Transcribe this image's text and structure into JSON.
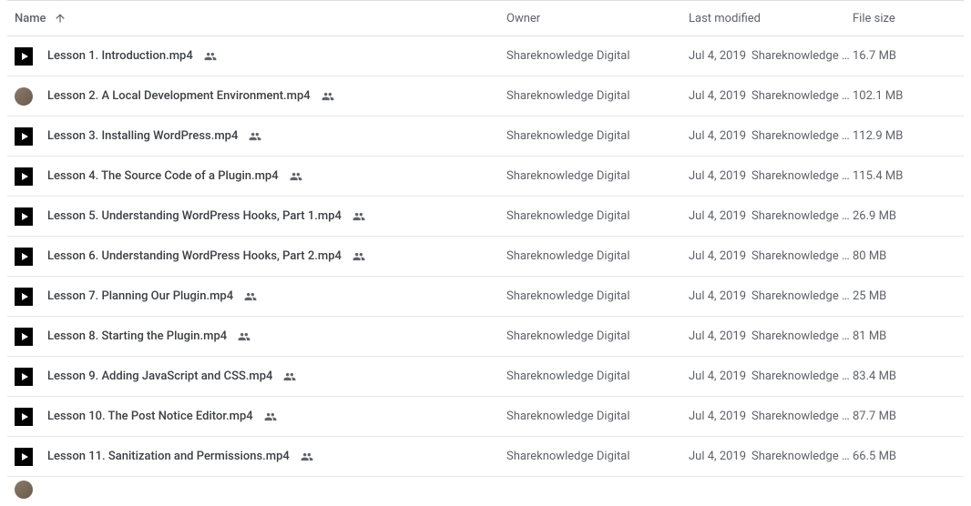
{
  "columns": {
    "name": "Name",
    "owner": "Owner",
    "modified": "Last modified",
    "size": "File size"
  },
  "files": [
    {
      "icon": "video",
      "name": "Lesson 1. Introduction.mp4",
      "shared": true,
      "owner": "Shareknowledge Digital",
      "modified_date": "Jul 4, 2019",
      "modified_by": "Shareknowledge Di…",
      "size": "16.7 MB"
    },
    {
      "icon": "round",
      "name": "Lesson 2. A Local Development Environment.mp4",
      "shared": true,
      "owner": "Shareknowledge Digital",
      "modified_date": "Jul 4, 2019",
      "modified_by": "Shareknowledge Di…",
      "size": "102.1 MB"
    },
    {
      "icon": "video",
      "name": "Lesson 3. Installing WordPress.mp4",
      "shared": true,
      "owner": "Shareknowledge Digital",
      "modified_date": "Jul 4, 2019",
      "modified_by": "Shareknowledge Di…",
      "size": "112.9 MB"
    },
    {
      "icon": "video",
      "name": "Lesson 4. The Source Code of a Plugin.mp4",
      "shared": true,
      "owner": "Shareknowledge Digital",
      "modified_date": "Jul 4, 2019",
      "modified_by": "Shareknowledge Di…",
      "size": "115.4 MB"
    },
    {
      "icon": "video",
      "name": "Lesson 5. Understanding WordPress Hooks, Part 1.mp4",
      "shared": true,
      "owner": "Shareknowledge Digital",
      "modified_date": "Jul 4, 2019",
      "modified_by": "Shareknowledge Di…",
      "size": "26.9 MB"
    },
    {
      "icon": "video",
      "name": "Lesson 6. Understanding WordPress Hooks, Part 2.mp4",
      "shared": true,
      "owner": "Shareknowledge Digital",
      "modified_date": "Jul 4, 2019",
      "modified_by": "Shareknowledge Di…",
      "size": "80 MB"
    },
    {
      "icon": "video",
      "name": "Lesson 7. Planning Our Plugin.mp4",
      "shared": true,
      "owner": "Shareknowledge Digital",
      "modified_date": "Jul 4, 2019",
      "modified_by": "Shareknowledge Di…",
      "size": "25 MB"
    },
    {
      "icon": "video",
      "name": "Lesson 8. Starting the Plugin.mp4",
      "shared": true,
      "owner": "Shareknowledge Digital",
      "modified_date": "Jul 4, 2019",
      "modified_by": "Shareknowledge Di…",
      "size": "81 MB"
    },
    {
      "icon": "video",
      "name": "Lesson 9. Adding JavaScript and CSS.mp4",
      "shared": true,
      "owner": "Shareknowledge Digital",
      "modified_date": "Jul 4, 2019",
      "modified_by": "Shareknowledge Di…",
      "size": "83.4 MB"
    },
    {
      "icon": "video",
      "name": "Lesson 10. The Post Notice Editor.mp4",
      "shared": true,
      "owner": "Shareknowledge Digital",
      "modified_date": "Jul 4, 2019",
      "modified_by": "Shareknowledge Di…",
      "size": "87.7 MB"
    },
    {
      "icon": "video",
      "name": "Lesson 11. Sanitization and Permissions.mp4",
      "shared": true,
      "owner": "Shareknowledge Digital",
      "modified_date": "Jul 4, 2019",
      "modified_by": "Shareknowledge Di…",
      "size": "66.5 MB"
    }
  ]
}
